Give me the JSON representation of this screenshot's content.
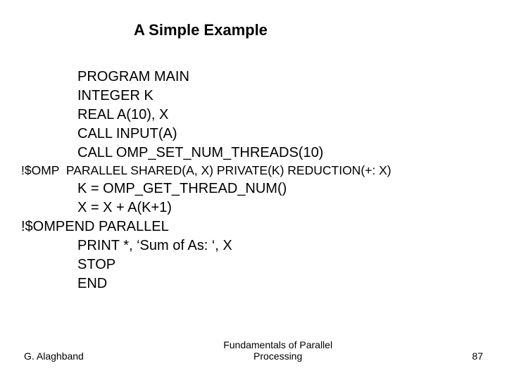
{
  "title": "A Simple Example",
  "code": {
    "l1": "PROGRAM MAIN",
    "l2": "INTEGER K",
    "l3": "REAL A(10), X",
    "l4": "CALL INPUT(A)",
    "l5": "CALL OMP_SET_NUM_THREADS(10)",
    "l6": "!$OMP  PARALLEL SHARED(A, X) PRIVATE(K) REDUCTION(+: X)",
    "l7": "K = OMP_GET_THREAD_NUM()",
    "l8": "X = X + A(K+1)",
    "l9": "!$OMPEND PARALLEL",
    "l10": "PRINT *, ‘Sum of As: ‘, X",
    "l11": "STOP",
    "l12": "END"
  },
  "footer": {
    "author": "G. Alaghband",
    "center_line1": "Fundamentals of Parallel",
    "center_line2": "Processing",
    "page": "87"
  }
}
